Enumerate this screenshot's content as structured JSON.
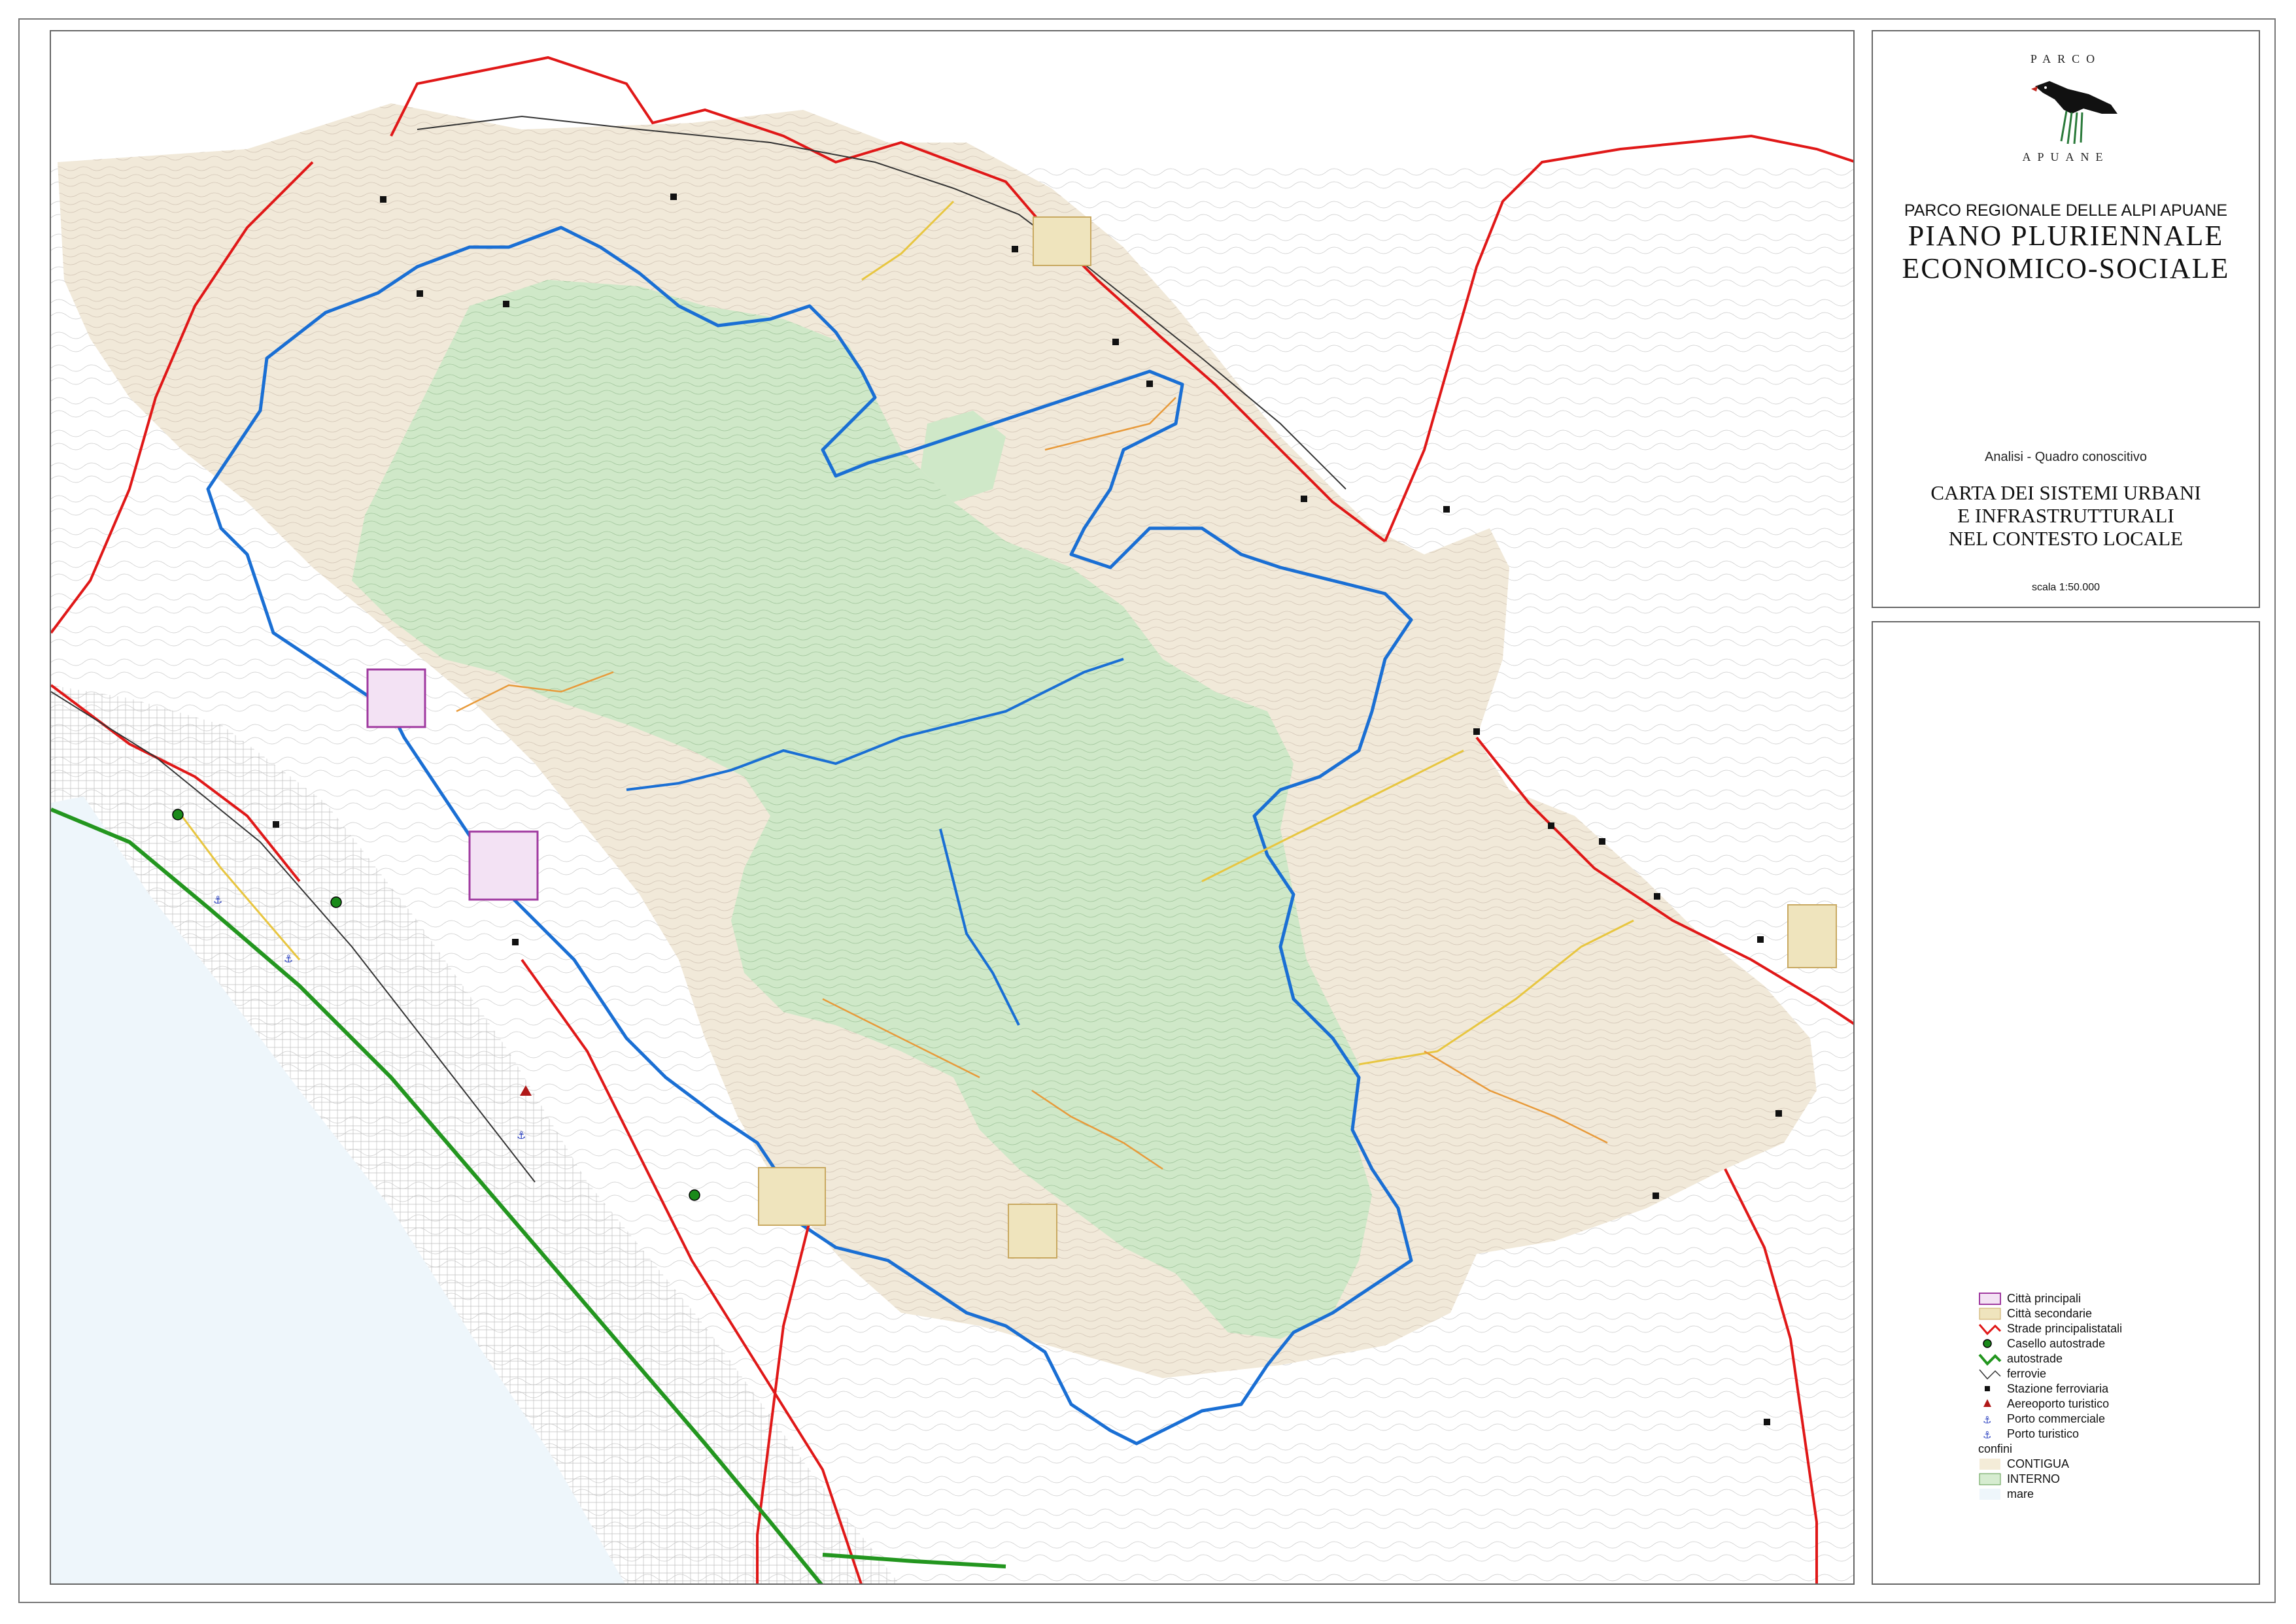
{
  "logo": {
    "top_text": "PARCO",
    "bottom_text": "APUANE"
  },
  "title": {
    "organization": "PARCO REGIONALE DELLE ALPI APUANE",
    "plan_line1": "PIANO  PLURIENNALE",
    "plan_line2": "ECONOMICO-SOCIALE",
    "analysis": "Analisi  -  Quadro conoscitivo",
    "map_line1": "CARTA DEI SISTEMI URBANI",
    "map_line2": "E INFRASTRUTTURALI",
    "map_line3": "NEL CONTESTO LOCALE",
    "scale": "scala 1:50.000"
  },
  "legend": [
    {
      "label": "Città principali",
      "icon": "pink-square",
      "color": "#f3e2f4"
    },
    {
      "label": "Città secondarie",
      "icon": "tan-square",
      "color": "#efe4bd"
    },
    {
      "label": "Strade principalistatali",
      "icon": "red-line",
      "color": "#e01818"
    },
    {
      "label": "Casello autostrade",
      "icon": "green-dot",
      "color": "#1a8a1a"
    },
    {
      "label": "autostrade",
      "icon": "green-line",
      "color": "#23961f"
    },
    {
      "label": "ferrovie",
      "icon": "black-line",
      "color": "#333333"
    },
    {
      "label": "Stazione ferroviaria",
      "icon": "black-square",
      "color": "#111111"
    },
    {
      "label": "Aereoporto turistico",
      "icon": "red-triangle",
      "color": "#b01818"
    },
    {
      "label": "Porto commerciale",
      "icon": "anchor-icon",
      "color": "#2a40c0"
    },
    {
      "label": "Porto turistico",
      "icon": "anchor-icon",
      "color": "#2a40c0"
    },
    {
      "label": "confini",
      "icon": "none",
      "color": "#ffffff"
    },
    {
      "label": "CONTIGUA",
      "icon": "beige-square",
      "color": "#f4ecd8"
    },
    {
      "label": "INTERNO",
      "icon": "green-square",
      "color": "#d6ecd0"
    },
    {
      "label": "mare",
      "icon": "sea-square",
      "color": "#eef6fb"
    }
  ],
  "colors": {
    "sea": "#eef6fb",
    "contigua": "#f1e9d9",
    "interno": "#cfe8c8",
    "park_boundary": "#1a6fd4",
    "main_roads": "#e01818",
    "motorway": "#23961f",
    "secondary_roads": "#e8c640",
    "local_roads": "#e89a3a"
  }
}
